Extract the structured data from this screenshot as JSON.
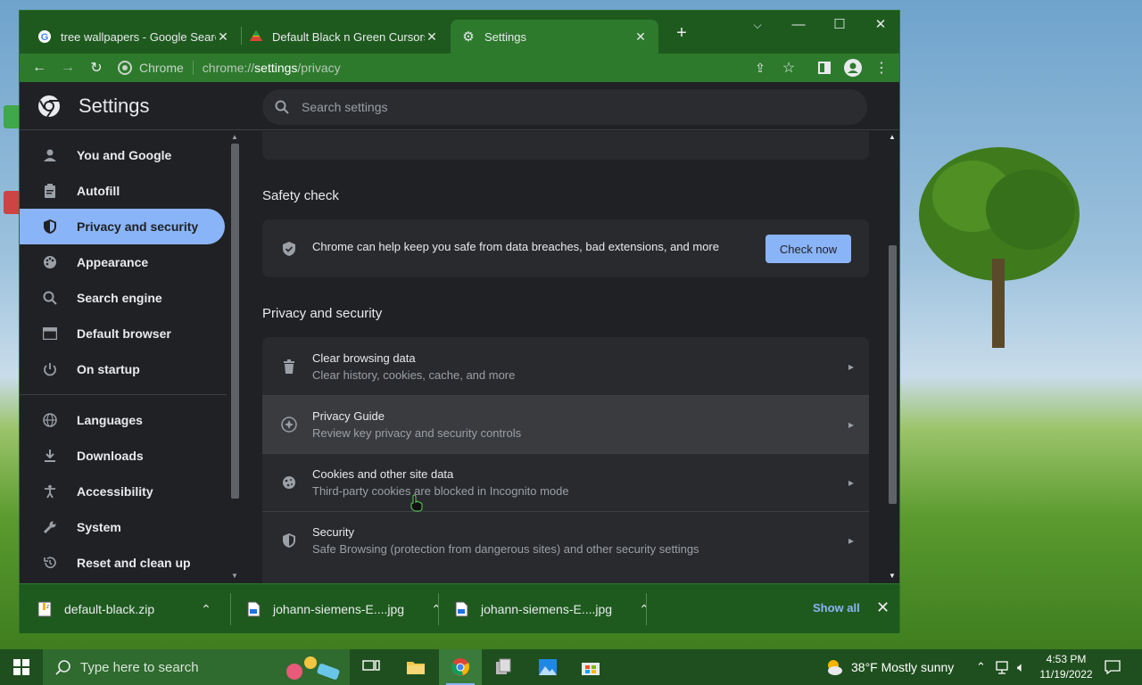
{
  "browser": {
    "tabs": [
      {
        "title": "tree wallpapers - Google Search",
        "icon": "google-icon"
      },
      {
        "title": "Default Black n Green Cursors",
        "icon": "drive-icon"
      },
      {
        "title": "Settings",
        "icon": "gear-icon"
      }
    ],
    "address": {
      "site_chip": "Chrome",
      "url_prefix": "chrome://",
      "url_main": "settings",
      "url_suffix": "/privacy"
    }
  },
  "settings": {
    "title": "Settings",
    "search_placeholder": "Search settings",
    "nav": [
      {
        "label": "You and Google",
        "icon": "person-icon"
      },
      {
        "label": "Autofill",
        "icon": "clipboard-icon"
      },
      {
        "label": "Privacy and security",
        "icon": "shield-icon"
      },
      {
        "label": "Appearance",
        "icon": "palette-icon"
      },
      {
        "label": "Search engine",
        "icon": "search-icon"
      },
      {
        "label": "Default browser",
        "icon": "browser-icon"
      },
      {
        "label": "On startup",
        "icon": "power-icon"
      },
      {
        "label": "Languages",
        "icon": "globe-icon"
      },
      {
        "label": "Downloads",
        "icon": "download-icon"
      },
      {
        "label": "Accessibility",
        "icon": "accessibility-icon"
      },
      {
        "label": "System",
        "icon": "wrench-icon"
      },
      {
        "label": "Reset and clean up",
        "icon": "history-icon"
      }
    ],
    "safety_check": {
      "heading": "Safety check",
      "text": "Chrome can help keep you safe from data breaches, bad extensions, and more",
      "button": "Check now"
    },
    "privacy": {
      "heading": "Privacy and security",
      "rows": [
        {
          "title": "Clear browsing data",
          "subtitle": "Clear history, cookies, cache, and more",
          "icon": "trash-icon"
        },
        {
          "title": "Privacy Guide",
          "subtitle": "Review key privacy and security controls",
          "icon": "compass-icon"
        },
        {
          "title": "Cookies and other site data",
          "subtitle": "Third-party cookies are blocked in Incognito mode",
          "icon": "cookie-icon"
        },
        {
          "title": "Security",
          "subtitle": "Safe Browsing (protection from dangerous sites) and other security settings",
          "icon": "shield-icon"
        }
      ]
    }
  },
  "downloads": {
    "items": [
      {
        "name": "default-black.zip"
      },
      {
        "name": "johann-siemens-E....jpg"
      },
      {
        "name": "johann-siemens-E....jpg"
      }
    ],
    "show_all": "Show all"
  },
  "taskbar": {
    "search_placeholder": "Type here to search",
    "weather": "38°F  Mostly sunny",
    "time": "4:53 PM",
    "date": "11/19/2022"
  },
  "colors": {
    "accent": "#8ab4f8",
    "frame": "#2d7a2d",
    "background": "#202124"
  }
}
